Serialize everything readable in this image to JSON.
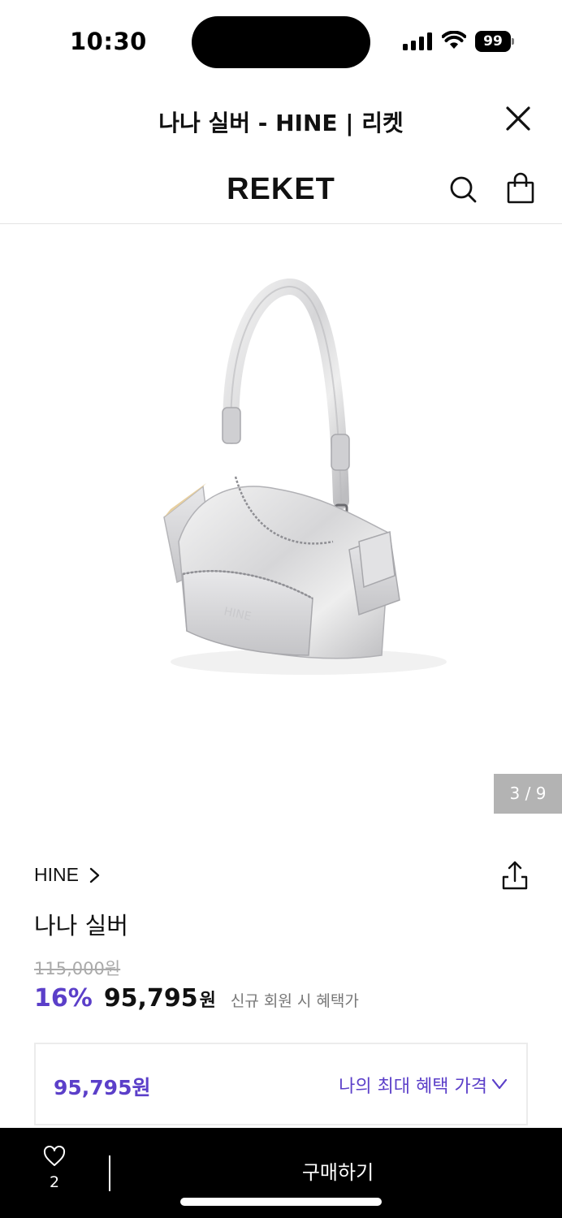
{
  "status_bar": {
    "time": "10:30",
    "battery": "99",
    "icons": [
      "cellular-signal-icon",
      "wifi-icon",
      "battery-icon"
    ]
  },
  "webview": {
    "title": "나나 실버 - HINE | 리켓",
    "close_icon": "close-icon"
  },
  "header": {
    "logo": "REKET",
    "icons": [
      "search-icon",
      "shopping-bag-icon"
    ]
  },
  "gallery": {
    "indicator": "3 / 9",
    "current": 3,
    "total": 9
  },
  "product": {
    "brand": "HINE",
    "name": "나나 실버",
    "original_price": "115,000원",
    "discount": "16%",
    "sale_price": "95,795",
    "currency": "원",
    "benefit_note": "신규 회원 시 혜택가"
  },
  "benefit_box": {
    "price": "95,795원",
    "label": "나의 최대 혜택 가격"
  },
  "bottom_bar": {
    "like_count": "2",
    "buy_label": "구매하기"
  },
  "colors": {
    "accent": "#5b3fc9",
    "bottom_bar": "#000000",
    "indicator_bg": "#b3b3b3"
  }
}
